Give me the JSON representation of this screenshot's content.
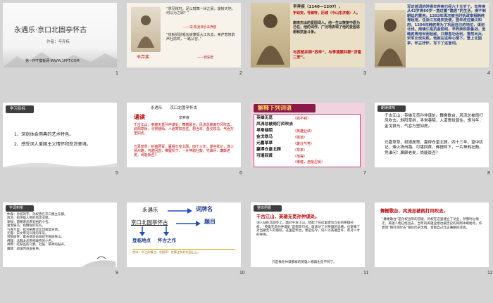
{
  "slide_numbers": [
    "1",
    "2",
    "3",
    "4",
    "5",
    "6",
    "7",
    "8",
    "9",
    "10",
    "11",
    "12"
  ],
  "s1": {
    "title": "永遇乐·京口北固亭怀古",
    "author": "作者：辛弃疾",
    "footer": "第一PPT模板网-WWW.1PPT.COM"
  },
  "s2": {
    "quote1": "“想见稼轩，足以鼓舞一世之豪；旋转天地，何以为之耶？”",
    "quote1_src": "——宋·陈亮评价辛弃疾",
    "quote2": "“铁板铜琶唱东坡慷慨大江东去，美芹悲愤鹃声杜鹃鸣，一路从容。”",
    "quote2_src": "——郭沫若",
    "caption": "辛弃疾"
  },
  "s3": {
    "heading": "辛弃疾（1140—1207），",
    "body_a": "字幼安，号稼轩，历城（今山东济南）人。",
    "body_b": "南宋杰出的爱国词人。他一生以恢复中原为己任，他的词作，广泛地表现了他的爱国思想和抗金斗争。",
    "highlight": "与苏轼并称“苏辛”，与李清照并称“济南二安”。"
  },
  "s4": {
    "text": "写这首词的时候辛弃疾已经六十五岁了。辛弃疾从42岁到60岁一直过着“隐居”的生活，得不到朝廷的重用。1203年再次被当时执政宰相韩侂胄起用，任浙江东路安抚使，翌年改任镇江知府。1204年韩侂胄为了巩固自己的地位，谋划北伐。南镇江是抗金前线，辛弃疾积极备战，但韩侂胄用世而轻敌，只想急功近利，冒然出兵，宋军北伐失败。他就在这种心情下，登上北固亭，怀古抒怀，写下了这首词。"
  },
  "s5": {
    "badge": "学习目标",
    "goal1": "1、深刻体会用典的艺术特色。",
    "goal1_em": "用典",
    "goal2": "2、感受词人爱国主义情怀和悲凉意境。"
  },
  "s6": {
    "title": "永遇乐　　京口北固亭怀古",
    "label": "诵读",
    "author": "辛弃疾",
    "p1": "千古江山，英雄无觅孙仲谋处。舞榭歌台，风流总被雨打风吹去。斜阳草树，寻常巷陌，人道寄奴曾住。想当年，金戈铁马，气吞万里如虎。",
    "p2": "元嘉草草，封狼居胥，赢得仓皇北顾。四十三年，望中犹记，烽火扬州路。可堪回首，佛狸祠下，一片神鸦社鼓。凭谁问：廉颇老矣，尚能饭否？"
  },
  "s7": {
    "banner": "解释下列词语",
    "items": [
      {
        "term": "英雄无觅",
        "gloss": "（找不到）"
      },
      {
        "term": "风流总被雨打风吹去",
        "gloss": ""
      },
      {
        "term": "寻常巷陌",
        "gloss": "（英雄业绩）"
      },
      {
        "term": "金戈铁马",
        "gloss": "（街道）"
      },
      {
        "term": "元嘉草草",
        "gloss": "（雄壮气势）"
      },
      {
        "term": "赢得仓皇北顾",
        "gloss": "（草率）"
      },
      {
        "term": "可堪回首",
        "gloss": "（落得）"
      },
      {
        "term": "",
        "gloss": "（哪堪，怎能忍受）"
      }
    ]
  },
  "s8": {
    "badge": "朗读体味",
    "p1": "千古江山，英雄无觅孙仲谋处。舞榭歌台，风流总被雨打风吹去。斜阳草树，寻常巷陌，人道寄奴曾住。想当年，金戈铁马，气吞万里如虎。",
    "p2": "元嘉草草，封狼居胥，赢得仓皇北顾。四十三年，望中犹记，烽火扬州路。可堪回首，佛狸祠下，一片神鸦社鼓。凭谁问：廉颇老矣，尚能饭否？"
  },
  "s9": {
    "badge": "字词积累",
    "text": "仲谋：孙权的字。孙权曾在京口建立东都。\n风流：指英雄人物的风流业绩。\n寄奴：南朝宋武帝刘裕的小名。\n金戈铁马：指精锐的军队。\n气吞万里：指刘裕两次北伐收复失地。\n元嘉：宋文帝刘义隆的年号。\n封狼居胥：霍去病追击匈奴至狼居胥山。\n佛狸：北魏太武帝拓跋焘的小名。\n神鸦：吃祭品的乌鸦。社鼓：祭神的鼓声。\n廉颇：战国时赵国名将。"
  },
  "s10": {
    "line1": "永遇乐",
    "label1": "词牌名",
    "line2": "京口北固亭怀古",
    "label2": "题目",
    "tag1": "登临地点",
    "tag2": "怀古之作",
    "note": "京口：今江苏镇江。北固亭：在镇江东北北固山上。"
  },
  "s11": {
    "badge": "整体把握",
    "headline": "千古江山，英雄无觅孙仲谋处。",
    "body": "词人站在北固亭上，面对千古江山，想起了在这里建功立业的英雄孙权。“英雄无觅孙仲谋处”是倒装句式，既表达了对英雄的追慕，也寄寓了对当朝无人的感叹。这里是怀古，更是伤今，词人以英雄自许，有对人才的呼唤。",
    "bottom": "只是像孙仲谋那样的英雄人物再也见不到了。"
  },
  "s12": {
    "headline": "舞榭歌台，风流总被雨打风吹去。",
    "body": "“舞榭歌台”是孙权当年的宫殿，孙权在这里建立了功业，然而时过境迁，英雄人物已经远去，当年的英雄业绩也被历史的风雨冲刷殆尽。作者借“雨打风吹去”感叹历史无情，寄寓自己壮志难酬的悲愤。"
  }
}
